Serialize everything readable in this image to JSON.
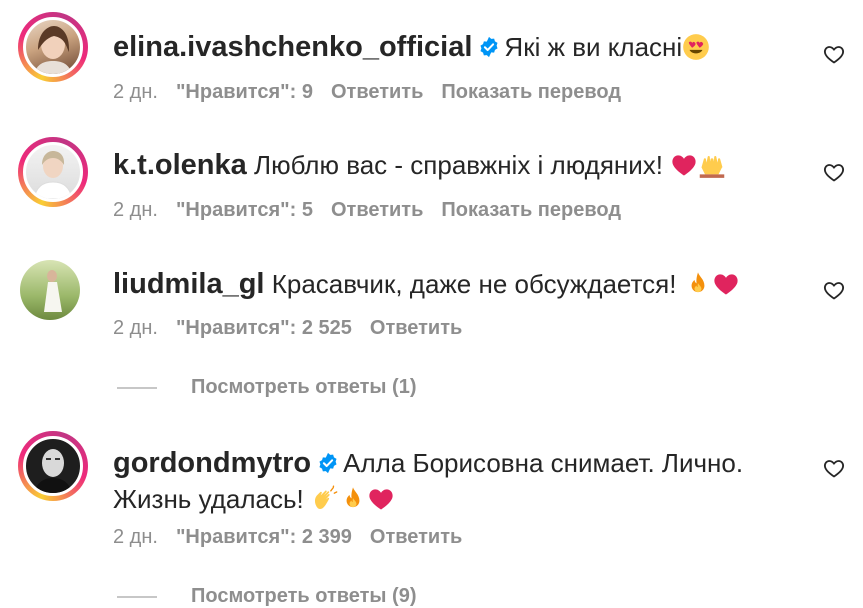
{
  "comments": [
    {
      "username": "elina.ivashchenko_official",
      "verified": true,
      "text": "Які ж ви класні",
      "emojis": [
        "heart-eyes"
      ],
      "time": "2 дн.",
      "likes": "\"Нравится\": 9",
      "reply": "Ответить",
      "translate": "Показать перевод"
    },
    {
      "username": "k.t.olenka",
      "verified": false,
      "text": "Люблю вас - справжніх і людяних!",
      "emojis": [
        "red-heart",
        "raised-hands"
      ],
      "time": "2 дн.",
      "likes": "\"Нравится\": 5",
      "reply": "Ответить",
      "translate": "Показать перевод"
    },
    {
      "username": "liudmila_gl",
      "verified": false,
      "text": "Красавчик, даже не обсуждается!",
      "emojis": [
        "fire",
        "red-heart"
      ],
      "time": "2 дн.",
      "likes": "\"Нравится\": 2 525",
      "reply": "Ответить",
      "view_replies": "Посмотреть ответы (1)"
    },
    {
      "username": "gordondmytro",
      "verified": true,
      "text": "Алла Борисовна снимает. Лично.",
      "text_line2": "Жизнь удалась!",
      "emojis": [
        "clapping-hands",
        "fire",
        "red-heart"
      ],
      "time": "2 дн.",
      "likes": "\"Нравится\": 2 399",
      "reply": "Ответить",
      "view_replies": "Посмотреть ответы (9)"
    }
  ],
  "colors": {
    "text": "#262626",
    "muted": "#8e8e8e",
    "verified": "#0095f6",
    "heart": "#e0245e"
  }
}
